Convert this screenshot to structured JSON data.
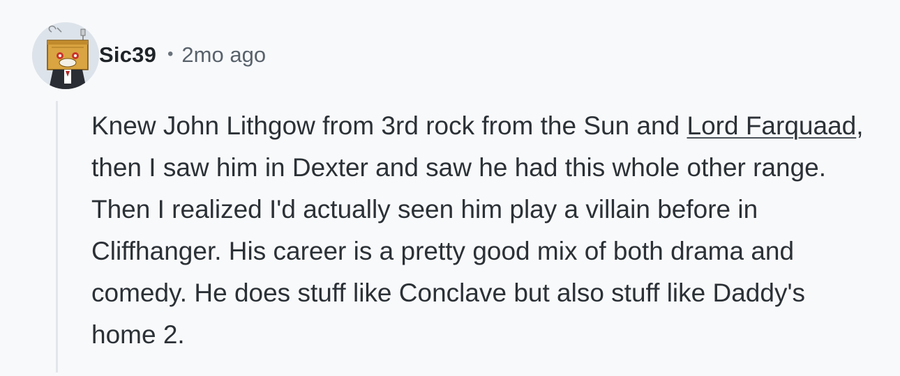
{
  "comment": {
    "author": "Sic39",
    "separator": "•",
    "timestamp": "2mo ago",
    "avatar_icon": "snoo-avatar-icon",
    "body": {
      "text_before_link": "Knew John Lithgow from 3rd rock from the Sun and ",
      "link_text": "Lord Farquaad",
      "text_after_link": ", then I saw him in Dexter and saw he had this whole other range. Then I realized I'd actually seen him play a villain before in Cliffhanger. His career is a pretty good mix of both drama and comedy. He does stuff like Conclave but also stuff like Daddy's home 2."
    }
  },
  "colors": {
    "background": "#f8f9fb",
    "text": "#2b3136",
    "meta": "#59626b",
    "thread_line": "#e3e6ea"
  }
}
